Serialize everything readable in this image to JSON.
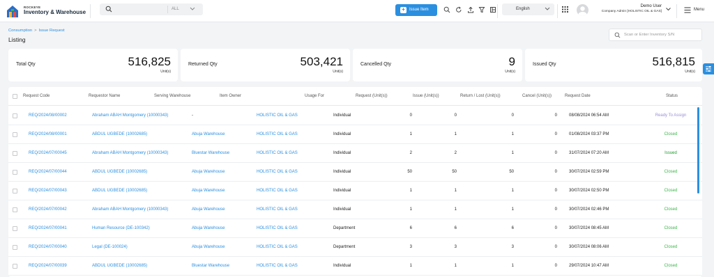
{
  "app": {
    "brand_small": "ROCKEYE",
    "brand_name": "Inventory & Warehouse"
  },
  "topbar": {
    "search_scope": "ALL",
    "issue_button": "Issue Item",
    "language": "English",
    "user_name": "Demo User",
    "user_role": "Company Admin [HOLISTIC OIL & GAS]",
    "menu_label": "Menu"
  },
  "breadcrumb": [
    "Consumption",
    "Issue Request"
  ],
  "page_title": "Listing",
  "scan_placeholder": "Scan or Enter Inventory S/N",
  "stats": [
    {
      "label": "Total Qty",
      "value": "516,825",
      "unit": "Unit(s)"
    },
    {
      "label": "Returned Qty",
      "value": "503,421",
      "unit": "Unit(s)"
    },
    {
      "label": "Cancelled Qty",
      "value": "9",
      "unit": "Unit(s)"
    },
    {
      "label": "Issued Qty",
      "value": "516,815",
      "unit": "Unit(s)"
    }
  ],
  "table": {
    "columns": [
      "Request Code",
      "Requestor Name",
      "Serving Warehouse",
      "Item Owner",
      "Usage For",
      "Request (Unit(s))",
      "Issue (Unit(s))",
      "Return / Lost (Unit(s))",
      "Cancel (Unit(s))",
      "Request Date",
      "Status"
    ],
    "rows": [
      {
        "code": "REQ/2024/08/00002",
        "requestor": "Abraham ABAH Montgomery (10000343)",
        "warehouse": "-",
        "owner": "HOLISTIC OIL & GAS",
        "usage": "Individual",
        "request": "0",
        "issue": "0",
        "return": "0",
        "cancel": "0",
        "date": "08/08/2024 06:54 AM",
        "status": "Ready To Assign"
      },
      {
        "code": "REQ/2024/08/00001",
        "requestor": "ABDUL UGBEDE (10002685)",
        "warehouse": "Abuja Warehouse",
        "owner": "HOLISTIC OIL & GAS",
        "usage": "Individual",
        "request": "1",
        "issue": "1",
        "return": "1",
        "cancel": "0",
        "date": "01/08/2024 03:37 PM",
        "status": "Closed"
      },
      {
        "code": "REQ/2024/07/00045",
        "requestor": "Abraham ABAH Montgomery (10000343)",
        "warehouse": "Bluestar Warehouse",
        "owner": "HOLISTIC OIL & GAS",
        "usage": "Individual",
        "request": "2",
        "issue": "2",
        "return": "1",
        "cancel": "0",
        "date": "31/07/2024 07:20 AM",
        "status": "Issued"
      },
      {
        "code": "REQ/2024/07/00044",
        "requestor": "ABDUL UGBEDE (10002685)",
        "warehouse": "Abuja Warehouse",
        "owner": "HOLISTIC OIL & GAS",
        "usage": "Individual",
        "request": "50",
        "issue": "50",
        "return": "50",
        "cancel": "0",
        "date": "30/07/2024 02:59 PM",
        "status": "Closed"
      },
      {
        "code": "REQ/2024/07/00043",
        "requestor": "ABDUL UGBEDE (10002685)",
        "warehouse": "Abuja Warehouse",
        "owner": "HOLISTIC OIL & GAS",
        "usage": "Individual",
        "request": "1",
        "issue": "1",
        "return": "1",
        "cancel": "0",
        "date": "30/07/2024 02:50 PM",
        "status": "Closed"
      },
      {
        "code": "REQ/2024/07/00042",
        "requestor": "Abraham ABAH Montgomery (10000343)",
        "warehouse": "Abuja Warehouse",
        "owner": "HOLISTIC OIL & GAS",
        "usage": "Individual",
        "request": "1",
        "issue": "1",
        "return": "1",
        "cancel": "0",
        "date": "30/07/2024 02:46 PM",
        "status": "Closed"
      },
      {
        "code": "REQ/2024/07/00041",
        "requestor": "Human Resource (DE-100342)",
        "warehouse": "Abuja Warehouse",
        "owner": "HOLISTIC OIL & GAS",
        "usage": "Department",
        "request": "6",
        "issue": "6",
        "return": "6",
        "cancel": "0",
        "date": "30/07/2024 08:45 AM",
        "status": "Closed"
      },
      {
        "code": "REQ/2024/07/00040",
        "requestor": "Legal (DE-100024)",
        "warehouse": "Abuja Warehouse",
        "owner": "HOLISTIC OIL & GAS",
        "usage": "Department",
        "request": "3",
        "issue": "3",
        "return": "3",
        "cancel": "0",
        "date": "30/07/2024 08:06 AM",
        "status": "Closed"
      },
      {
        "code": "REQ/2024/07/00039",
        "requestor": "ABDUL UGBEDE (10002685)",
        "warehouse": "Bluestar Warehouse",
        "owner": "HOLISTIC OIL & GAS",
        "usage": "Individual",
        "request": "1",
        "issue": "1",
        "return": "1",
        "cancel": "0",
        "date": "29/07/2024 10:47 AM",
        "status": "Closed"
      }
    ]
  },
  "colors": {
    "accent": "#2b8fe0",
    "status_closed": "#3cb64a",
    "status_issued": "#1f9a2e",
    "status_ready": "#9b8fd6"
  },
  "icons": [
    "logo-house-icon",
    "search-icon",
    "chevron-down-icon",
    "plus-icon",
    "refresh-icon",
    "upload-icon",
    "filter-icon",
    "report-icon",
    "apps-grid-icon",
    "hamburger-menu-icon",
    "sliders-icon"
  ]
}
